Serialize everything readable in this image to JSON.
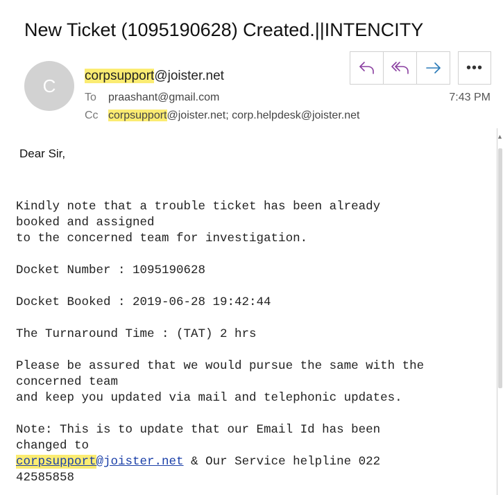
{
  "email": {
    "subject": "New Ticket (1095190628) Created.||INTENCITY",
    "avatar_initial": "C",
    "from_highlight": "corpsupport",
    "from_rest": "@joister.net",
    "to_label": "To",
    "to": "praashant@gmail.com",
    "cc_label": "Cc",
    "cc_highlight": "corpsupport",
    "cc_rest": "@joister.net; corp.helpdesk@joister.net",
    "time": "7:43 PM",
    "greeting": "Dear Sir,",
    "body_lines": [
      "Kindly note that a trouble ticket has been already",
      "booked and assigned",
      "to the concerned team for investigation.",
      "",
      "Docket Number : 1095190628",
      "",
      "Docket Booked : 2019-06-28 19:42:44",
      "",
      "The Turnaround Time : (TAT) 2 hrs",
      "",
      "Please be assured that we would pursue the same with the",
      "concerned team",
      "and keep you updated via mail and telephonic updates.",
      "",
      "Note: This is to update that our Email Id has been",
      "changed to"
    ],
    "link_highlight": "corpsupport",
    "link_rest": "@joister.net",
    "after_link": " & Our Service helpline 022",
    "last_line": "42585858"
  },
  "toolbar": {
    "reply_icon": "reply-icon",
    "reply_all_icon": "reply-all-icon",
    "forward_icon": "forward-icon",
    "more_label": "•••"
  },
  "colors": {
    "highlight": "#fbec72",
    "reply_purple": "#8a3fa0",
    "forward_blue": "#2a7ab8",
    "link_blue": "#1a3fa8"
  }
}
